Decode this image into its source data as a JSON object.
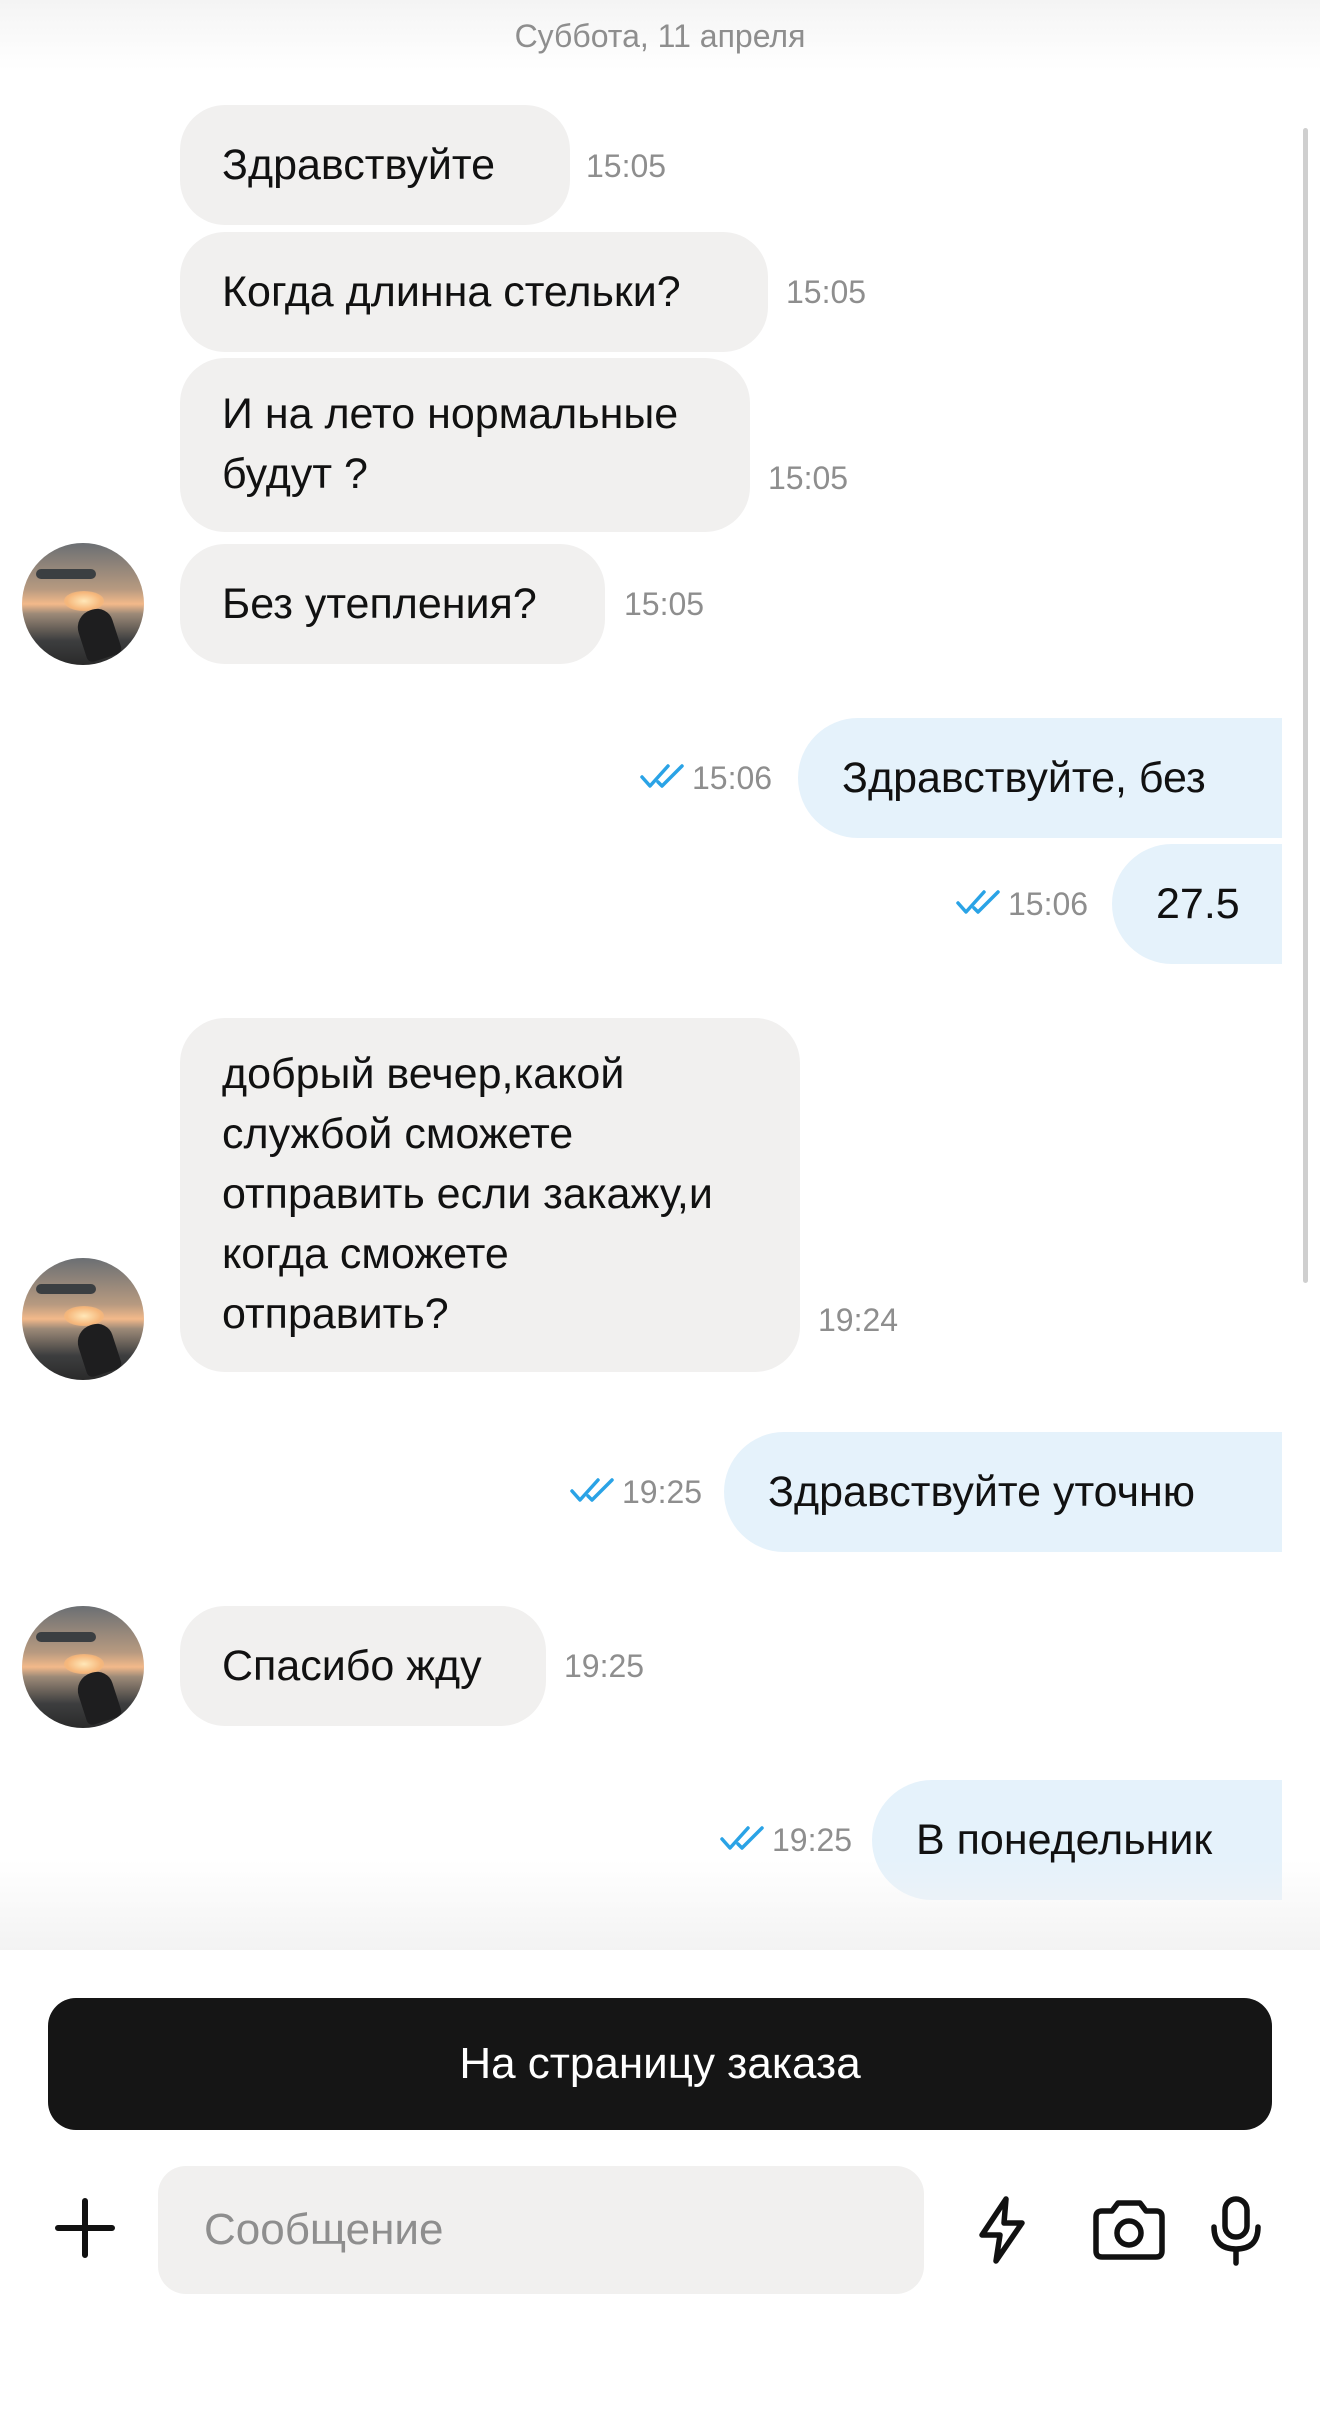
{
  "date_header": "Суббота, 11 апреля",
  "colors": {
    "incoming": "#f1f0ef",
    "outgoing": "#e5f2fb",
    "read_ticks": "#2aa3e6",
    "button": "#151515"
  },
  "messages": [
    {
      "dir": "in",
      "text": "Здравствуйте",
      "time": "15:05"
    },
    {
      "dir": "in",
      "text": "Когда длинна стельки?",
      "time": "15:05"
    },
    {
      "dir": "in",
      "lines": [
        "И на лето нормальные",
        "будут ?"
      ],
      "time": "15:05"
    },
    {
      "dir": "in",
      "text": "Без утепления?",
      "time": "15:05"
    },
    {
      "dir": "out",
      "text": "Здравствуйте, без",
      "time": "15:06",
      "status": "read"
    },
    {
      "dir": "out",
      "text": "27.5",
      "time": "15:06",
      "status": "read"
    },
    {
      "dir": "in",
      "lines": [
        "добрый вечер,какой",
        "службой сможете",
        "отправить если закажу,и",
        "когда сможете",
        "отправить?"
      ],
      "time": "19:24"
    },
    {
      "dir": "out",
      "text": "Здравствуйте уточню",
      "time": "19:25",
      "status": "read"
    },
    {
      "dir": "in",
      "text": "Спасибо жду",
      "time": "19:25"
    },
    {
      "dir": "out",
      "text": "В понедельник",
      "time": "19:25",
      "status": "read"
    }
  ],
  "order_button": "На страницу заказа",
  "composer": {
    "placeholder": "Сообщение",
    "icons": [
      "plus-icon",
      "lightning-icon",
      "camera-icon",
      "microphone-icon"
    ]
  }
}
